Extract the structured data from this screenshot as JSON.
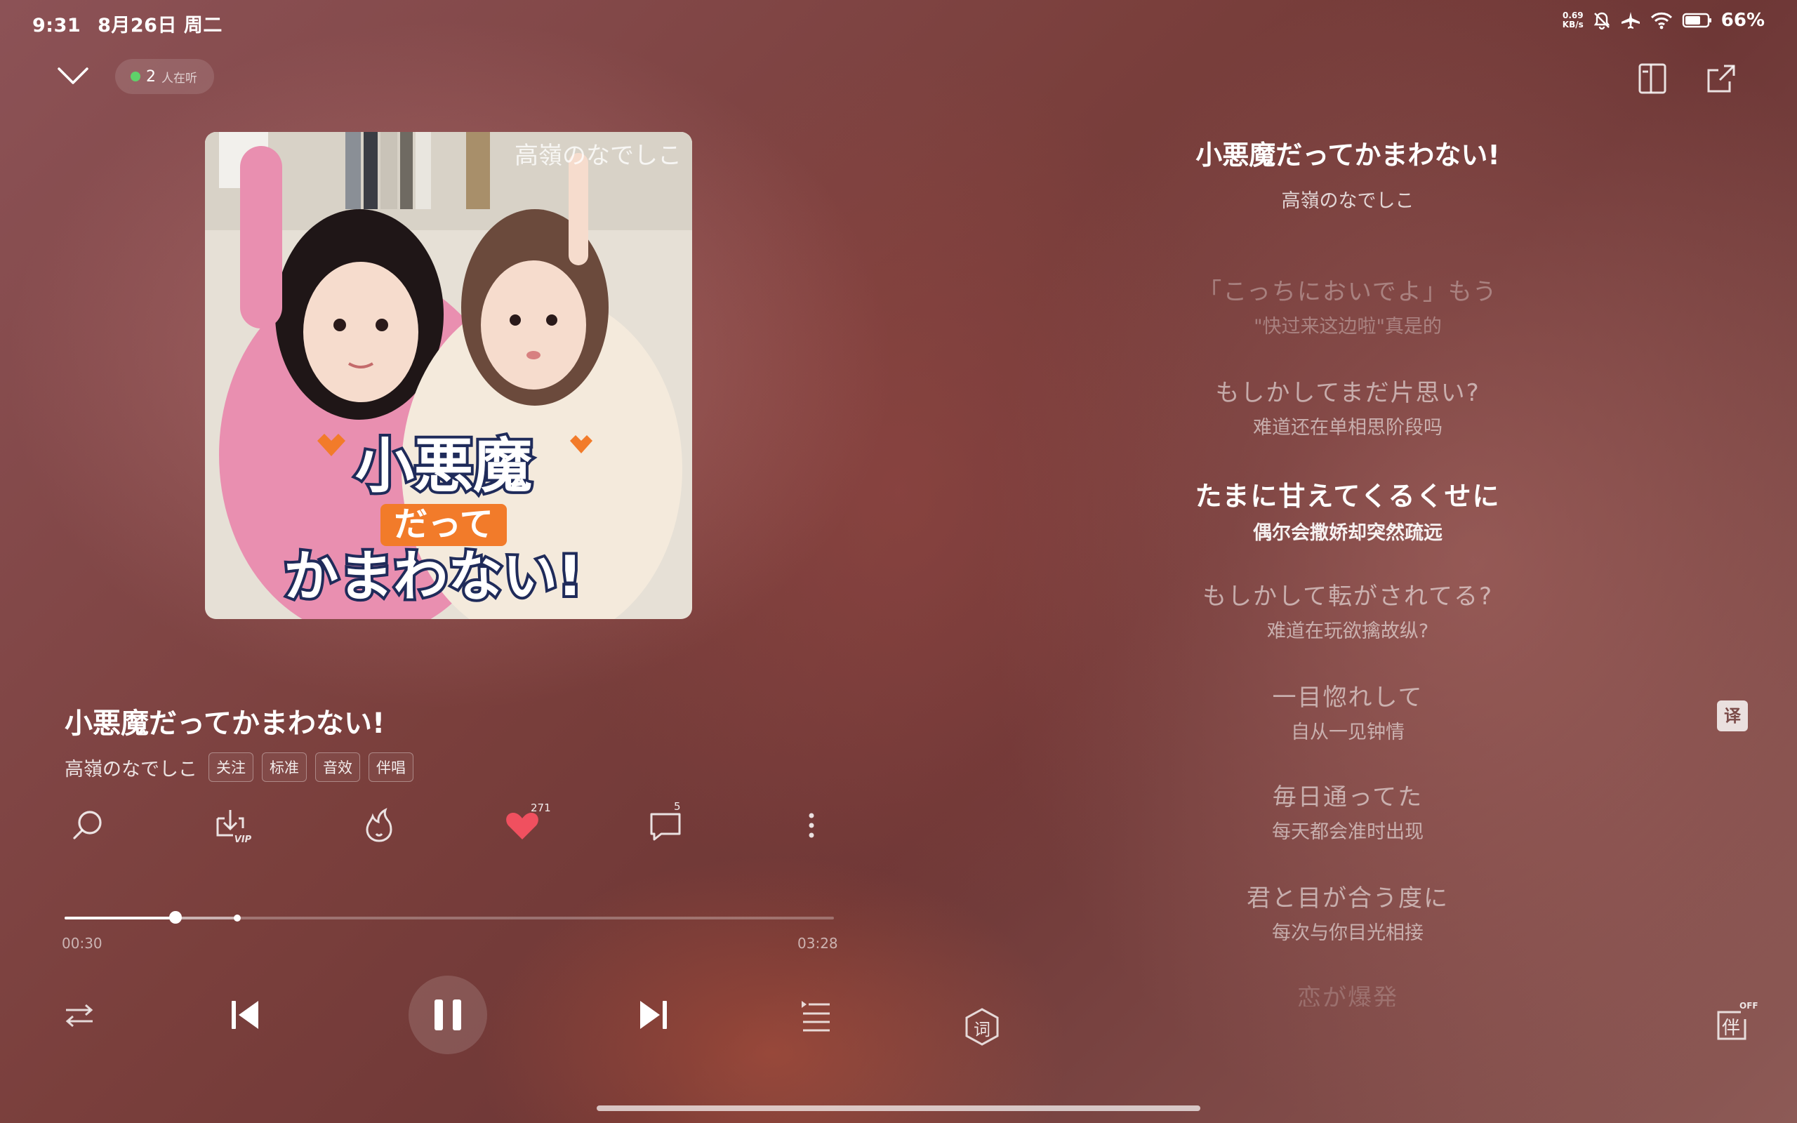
{
  "status_bar": {
    "time": "9:31",
    "date": "8月26日 周二",
    "net_speed_value": "0.69",
    "net_speed_unit": "KB/s",
    "battery": "66%",
    "icons": [
      "mute-bell-icon",
      "airplane-icon",
      "wifi-icon",
      "battery-icon"
    ]
  },
  "header": {
    "listeners_count": "2",
    "listeners_label": "人在听"
  },
  "album": {
    "cover_artist_text": "高嶺のなでしこ",
    "cover_title_text": "小悪魔だってかまわない!"
  },
  "song": {
    "title": "小悪魔だってかまわない!",
    "artist": "高嶺のなでしこ",
    "tags": [
      "关注",
      "标准",
      "音效",
      "伴唱"
    ]
  },
  "actions": {
    "like_count": "271",
    "comment_count": "5",
    "like_color": "#f0505f"
  },
  "progress": {
    "current": "00:30",
    "total": "03:28",
    "played_fraction": 0.144,
    "buffered_fraction": 0.224
  },
  "lyrics": {
    "title": "小悪魔だってかまわない!",
    "artist": "高嶺のなでしこ",
    "lines": [
      {
        "jp": "「こっちにおいでよ」もう",
        "zh": "\"快过来这边啦\"真是的",
        "state": "faded"
      },
      {
        "jp": "もしかしてまだ片思い?",
        "zh": "难道还在单相思阶段吗",
        "state": "normal"
      },
      {
        "jp": "たまに甘えてくるくせに",
        "zh": "偶尔会撒娇却突然疏远",
        "state": "current"
      },
      {
        "jp": "もしかして転がされてる?",
        "zh": "难道在玩欲擒故纵?",
        "state": "normal"
      },
      {
        "jp": "一目惚れして",
        "zh": "自从一见钟情",
        "state": "normal"
      },
      {
        "jp": "毎日通ってた",
        "zh": "每天都会准时出现",
        "state": "normal"
      },
      {
        "jp": "君と目が合う度に",
        "zh": "每次与你目光相接",
        "state": "normal"
      },
      {
        "jp": "恋が爆発",
        "zh": "",
        "state": "fading"
      }
    ],
    "translate_label": "译",
    "lyrics_mode_label": "词",
    "accompany_label": "伴",
    "accompany_state": "OFF"
  }
}
